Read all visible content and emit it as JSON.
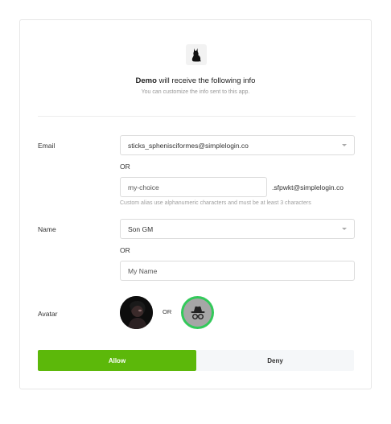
{
  "header": {
    "app_name": "Demo",
    "headline_rest": " will receive the following info",
    "subline": "You can customize the info sent to this app.",
    "logo_icon": "cat-icon"
  },
  "email": {
    "label": "Email",
    "selected_value": "sticks_sphenisciformes@simplelogin.co",
    "or_label": "OR",
    "custom_value": "my-choice",
    "suffix": ".sfpwkt@simplelogin.co",
    "hint": "Custom alias use alphanumeric characters and must be at least 3 characters"
  },
  "name": {
    "label": "Name",
    "selected_value": "Son GM",
    "or_label": "OR",
    "custom_value": "My Name"
  },
  "avatar": {
    "label": "Avatar",
    "or_label": "OR",
    "default_icon": "incognito-icon"
  },
  "actions": {
    "allow_label": "Allow",
    "deny_label": "Deny"
  },
  "colors": {
    "allow": "#5cb80a",
    "deny_bg": "#f5f7f9",
    "default_avatar_ring": "#33c95a"
  }
}
